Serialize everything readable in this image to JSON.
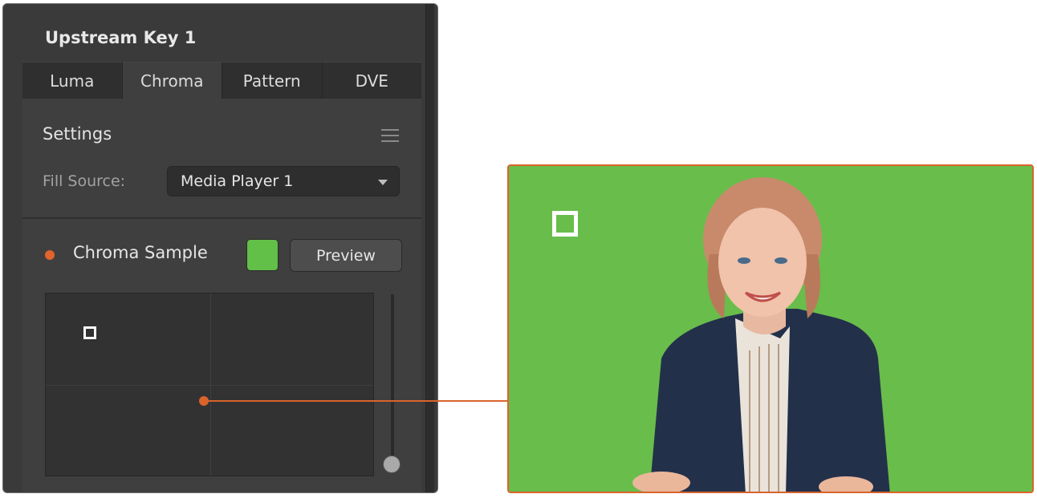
{
  "panel": {
    "title": "Upstream Key 1",
    "tabs": [
      {
        "label": "Luma"
      },
      {
        "label": "Chroma",
        "active": true
      },
      {
        "label": "Pattern"
      },
      {
        "label": "DVE"
      }
    ],
    "settings": {
      "title": "Settings",
      "menu_icon": "hamburger-menu-icon",
      "fill_source_label": "Fill Source:",
      "fill_source_value": "Media Player 1"
    },
    "chroma_sample": {
      "label": "Chroma Sample",
      "indicator_color": "#e0642c",
      "swatch_color": "#62bf48",
      "preview_label": "Preview"
    }
  },
  "colors": {
    "accent": "#d8642c",
    "green_screen": "#69bd4b",
    "panel_bg": "#3a3a3a"
  }
}
